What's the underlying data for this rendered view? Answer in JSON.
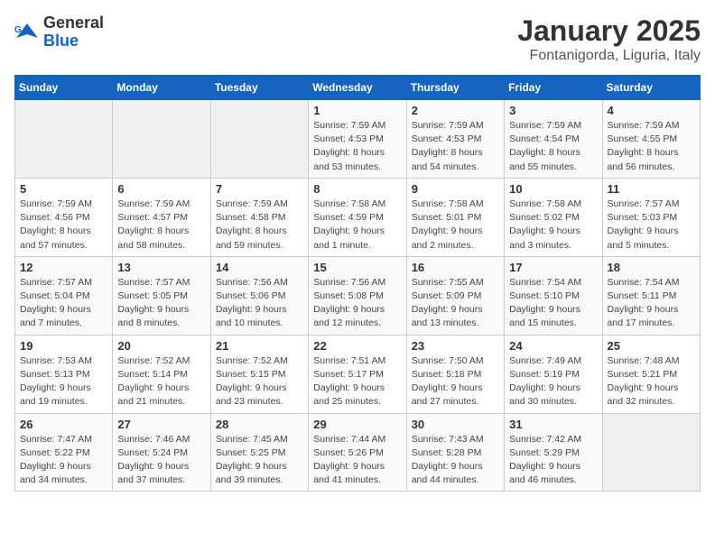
{
  "header": {
    "logo_general": "General",
    "logo_blue": "Blue",
    "title": "January 2025",
    "subtitle": "Fontanigorda, Liguria, Italy"
  },
  "columns": [
    "Sunday",
    "Monday",
    "Tuesday",
    "Wednesday",
    "Thursday",
    "Friday",
    "Saturday"
  ],
  "weeks": [
    [
      {
        "day": "",
        "info": ""
      },
      {
        "day": "",
        "info": ""
      },
      {
        "day": "",
        "info": ""
      },
      {
        "day": "1",
        "info": "Sunrise: 7:59 AM\nSunset: 4:53 PM\nDaylight: 8 hours\nand 53 minutes."
      },
      {
        "day": "2",
        "info": "Sunrise: 7:59 AM\nSunset: 4:53 PM\nDaylight: 8 hours\nand 54 minutes."
      },
      {
        "day": "3",
        "info": "Sunrise: 7:59 AM\nSunset: 4:54 PM\nDaylight: 8 hours\nand 55 minutes."
      },
      {
        "day": "4",
        "info": "Sunrise: 7:59 AM\nSunset: 4:55 PM\nDaylight: 8 hours\nand 56 minutes."
      }
    ],
    [
      {
        "day": "5",
        "info": "Sunrise: 7:59 AM\nSunset: 4:56 PM\nDaylight: 8 hours\nand 57 minutes."
      },
      {
        "day": "6",
        "info": "Sunrise: 7:59 AM\nSunset: 4:57 PM\nDaylight: 8 hours\nand 58 minutes."
      },
      {
        "day": "7",
        "info": "Sunrise: 7:59 AM\nSunset: 4:58 PM\nDaylight: 8 hours\nand 59 minutes."
      },
      {
        "day": "8",
        "info": "Sunrise: 7:58 AM\nSunset: 4:59 PM\nDaylight: 9 hours\nand 1 minute."
      },
      {
        "day": "9",
        "info": "Sunrise: 7:58 AM\nSunset: 5:01 PM\nDaylight: 9 hours\nand 2 minutes."
      },
      {
        "day": "10",
        "info": "Sunrise: 7:58 AM\nSunset: 5:02 PM\nDaylight: 9 hours\nand 3 minutes."
      },
      {
        "day": "11",
        "info": "Sunrise: 7:57 AM\nSunset: 5:03 PM\nDaylight: 9 hours\nand 5 minutes."
      }
    ],
    [
      {
        "day": "12",
        "info": "Sunrise: 7:57 AM\nSunset: 5:04 PM\nDaylight: 9 hours\nand 7 minutes."
      },
      {
        "day": "13",
        "info": "Sunrise: 7:57 AM\nSunset: 5:05 PM\nDaylight: 9 hours\nand 8 minutes."
      },
      {
        "day": "14",
        "info": "Sunrise: 7:56 AM\nSunset: 5:06 PM\nDaylight: 9 hours\nand 10 minutes."
      },
      {
        "day": "15",
        "info": "Sunrise: 7:56 AM\nSunset: 5:08 PM\nDaylight: 9 hours\nand 12 minutes."
      },
      {
        "day": "16",
        "info": "Sunrise: 7:55 AM\nSunset: 5:09 PM\nDaylight: 9 hours\nand 13 minutes."
      },
      {
        "day": "17",
        "info": "Sunrise: 7:54 AM\nSunset: 5:10 PM\nDaylight: 9 hours\nand 15 minutes."
      },
      {
        "day": "18",
        "info": "Sunrise: 7:54 AM\nSunset: 5:11 PM\nDaylight: 9 hours\nand 17 minutes."
      }
    ],
    [
      {
        "day": "19",
        "info": "Sunrise: 7:53 AM\nSunset: 5:13 PM\nDaylight: 9 hours\nand 19 minutes."
      },
      {
        "day": "20",
        "info": "Sunrise: 7:52 AM\nSunset: 5:14 PM\nDaylight: 9 hours\nand 21 minutes."
      },
      {
        "day": "21",
        "info": "Sunrise: 7:52 AM\nSunset: 5:15 PM\nDaylight: 9 hours\nand 23 minutes."
      },
      {
        "day": "22",
        "info": "Sunrise: 7:51 AM\nSunset: 5:17 PM\nDaylight: 9 hours\nand 25 minutes."
      },
      {
        "day": "23",
        "info": "Sunrise: 7:50 AM\nSunset: 5:18 PM\nDaylight: 9 hours\nand 27 minutes."
      },
      {
        "day": "24",
        "info": "Sunrise: 7:49 AM\nSunset: 5:19 PM\nDaylight: 9 hours\nand 30 minutes."
      },
      {
        "day": "25",
        "info": "Sunrise: 7:48 AM\nSunset: 5:21 PM\nDaylight: 9 hours\nand 32 minutes."
      }
    ],
    [
      {
        "day": "26",
        "info": "Sunrise: 7:47 AM\nSunset: 5:22 PM\nDaylight: 9 hours\nand 34 minutes."
      },
      {
        "day": "27",
        "info": "Sunrise: 7:46 AM\nSunset: 5:24 PM\nDaylight: 9 hours\nand 37 minutes."
      },
      {
        "day": "28",
        "info": "Sunrise: 7:45 AM\nSunset: 5:25 PM\nDaylight: 9 hours\nand 39 minutes."
      },
      {
        "day": "29",
        "info": "Sunrise: 7:44 AM\nSunset: 5:26 PM\nDaylight: 9 hours\nand 41 minutes."
      },
      {
        "day": "30",
        "info": "Sunrise: 7:43 AM\nSunset: 5:28 PM\nDaylight: 9 hours\nand 44 minutes."
      },
      {
        "day": "31",
        "info": "Sunrise: 7:42 AM\nSunset: 5:29 PM\nDaylight: 9 hours\nand 46 minutes."
      },
      {
        "day": "",
        "info": ""
      }
    ]
  ]
}
